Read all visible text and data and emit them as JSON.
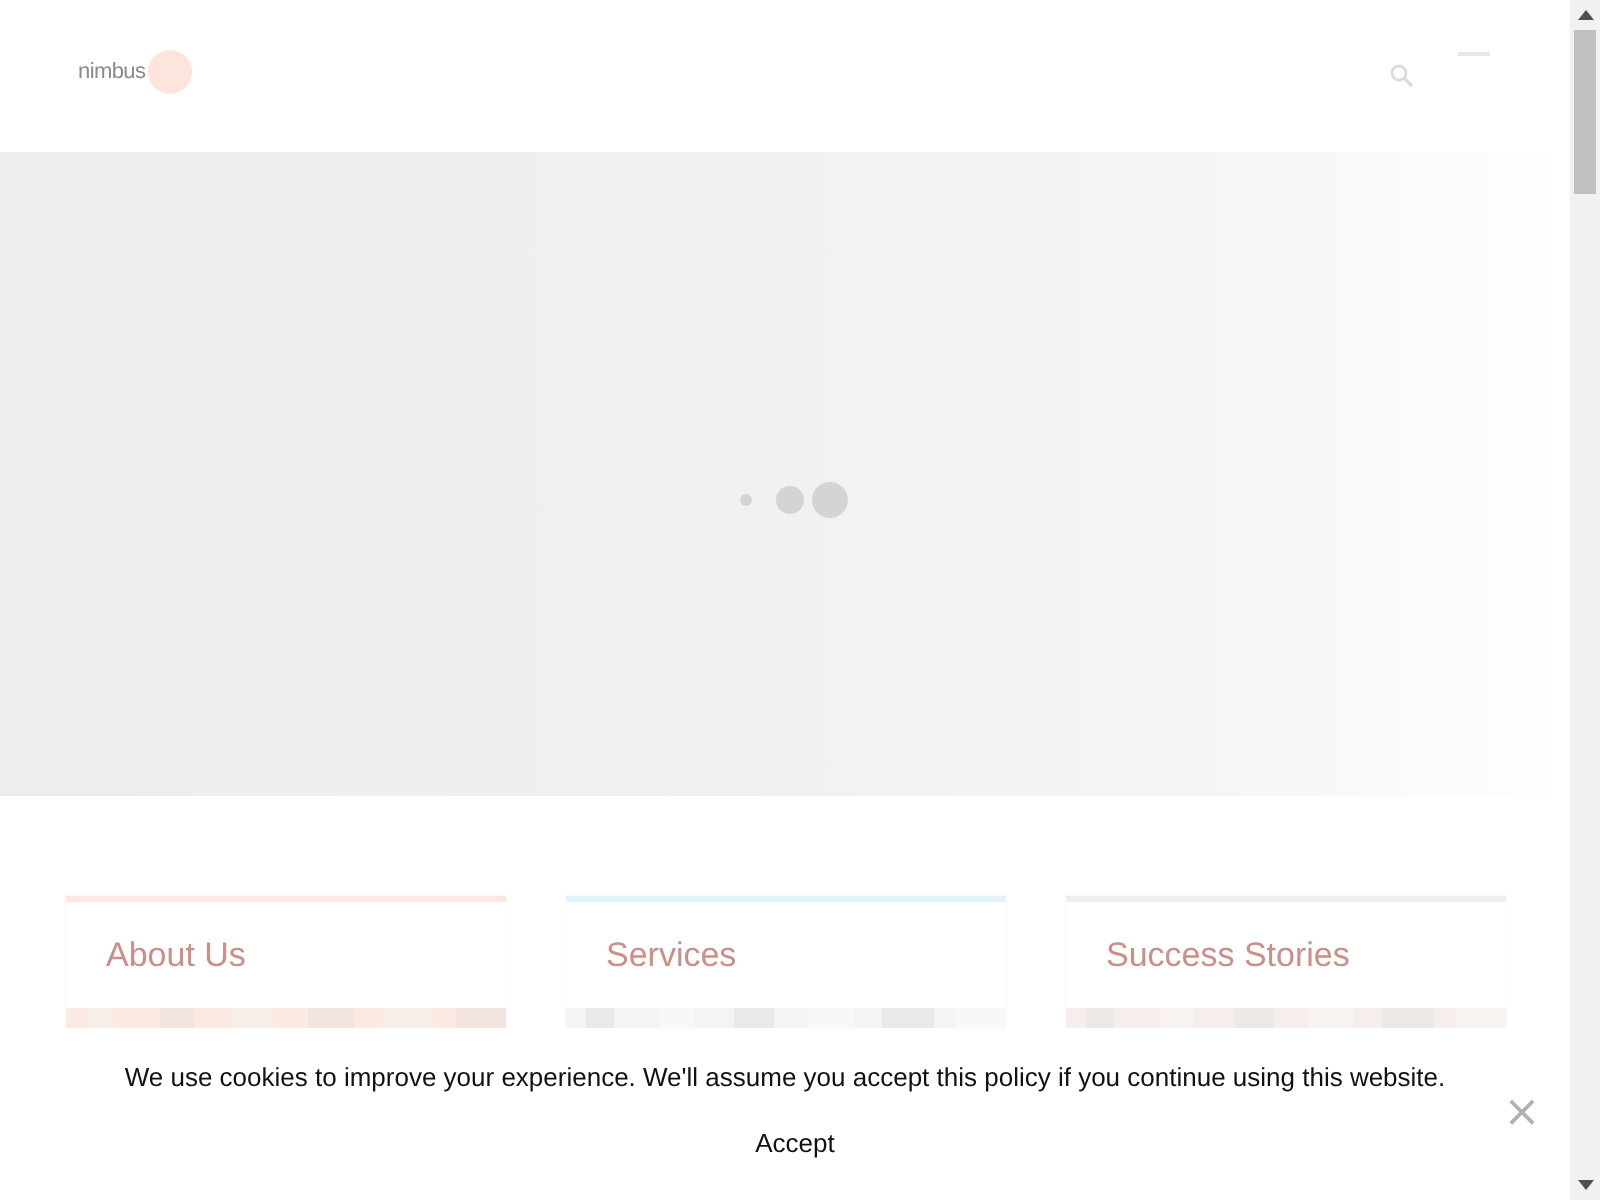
{
  "header": {
    "logo_text": "nimbus"
  },
  "hero": {
    "loading": true
  },
  "cards": [
    {
      "title": "About Us",
      "color": "#fde6e3"
    },
    {
      "title": "Services",
      "color": "#e3f3fb"
    },
    {
      "title": "Success Stories",
      "color": "#eceeee"
    }
  ],
  "cookie_bar": {
    "message": "We use cookies to improve your experience. We'll assume you accept this policy if you continue using this website.",
    "accept": "Accept",
    "close": "×"
  }
}
